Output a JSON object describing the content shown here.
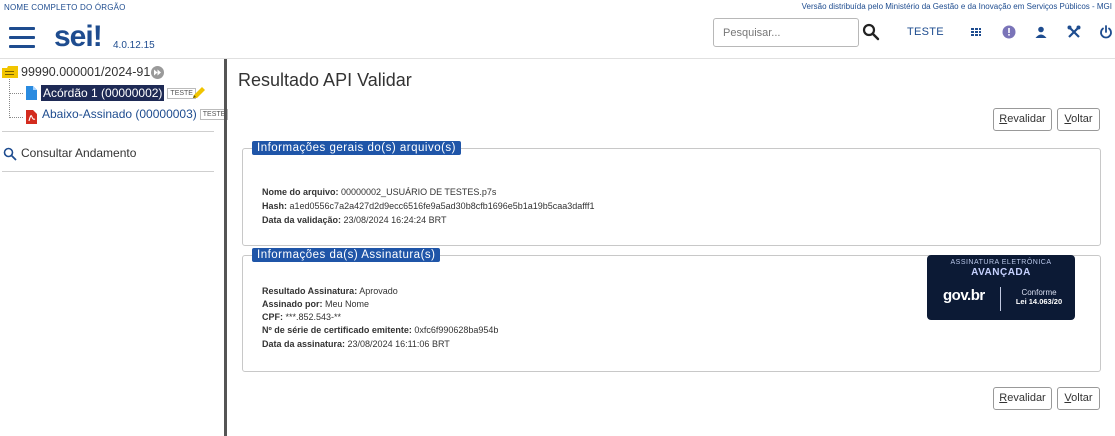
{
  "top": {
    "org_name": "NOME COMPLETO DO ÓRGÃO",
    "distribution": "Versão distribuída pelo Ministério da Gestão e da Inovação em Serviços Públicos - MGI"
  },
  "header": {
    "logo": "sei",
    "logo_bang": "!",
    "version": "4.0.12.15",
    "search_placeholder": "Pesquisar...",
    "unit": "TESTE",
    "icons": [
      "menu-icon",
      "search-icon",
      "grid-icon",
      "info-icon",
      "user-icon",
      "tools-icon",
      "power-icon"
    ]
  },
  "sidebar": {
    "process": "99990.000001/2024-91",
    "documents": [
      {
        "label": "Acórdão 1 (00000002)",
        "tag": "TESTE",
        "selected": true
      },
      {
        "label": "Abaixo-Assinado (00000003)",
        "tag": "TESTE",
        "selected": false
      }
    ],
    "consultar": "Consultar Andamento"
  },
  "main": {
    "title": "Resultado API Validar",
    "buttons": {
      "revalidar_first": "R",
      "revalidar_rest": "evalidar",
      "voltar_first": "V",
      "voltar_rest": "oltar"
    },
    "file_info": {
      "legend": "Informações gerais do(s) arquivo(s)",
      "rows": [
        {
          "label": "Nome do arquivo:",
          "value": " 00000002_USUÁRIO DE TESTES.p7s"
        },
        {
          "label": "Hash:",
          "value": " a1ed0556c7a2a427d2d9ecc6516fe9a5ad30b8cfb1696e5b1a19b5caa3dafff1"
        },
        {
          "label": "Data da validação:",
          "value": " 23/08/2024 16:24:24 BRT"
        }
      ]
    },
    "sig_info": {
      "legend": "Informações da(s) Assinatura(s)",
      "rows": [
        {
          "label": "Resultado Assinatura:",
          "value": " Aprovado"
        },
        {
          "label": "Assinado por:",
          "value": " Meu Nome"
        },
        {
          "label": "CPF:",
          "value": " ***.852.543-**"
        },
        {
          "label": "Nº de série de certificado emitente:",
          "value": " 0xfc6f990628ba954b"
        },
        {
          "label": "Data da assinatura:",
          "value": " 23/08/2024 16:11:06 BRT"
        }
      ]
    },
    "seal": {
      "line1": "ASSINATURA ELETRÔNICA",
      "line2": "AVANÇADA",
      "brand": "gov.br",
      "status": "Conforme",
      "law": "Lei 14.063/20"
    }
  }
}
